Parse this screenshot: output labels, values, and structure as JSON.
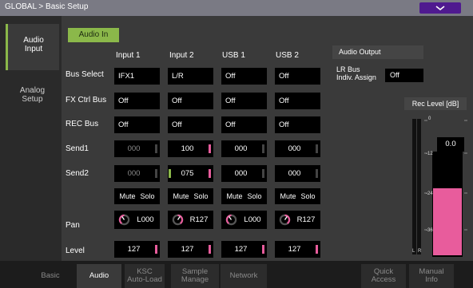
{
  "title": "GLOBAL > Basic Setup",
  "sidebar": {
    "tabs": [
      {
        "label_lines": [
          "Audio",
          "Input"
        ],
        "active": true
      },
      {
        "label_lines": [
          "Analog",
          "Setup"
        ],
        "active": false
      }
    ]
  },
  "audio_in_button": "Audio In",
  "columns": [
    "Input 1",
    "Input 2",
    "USB 1",
    "USB 2"
  ],
  "row_labels": {
    "bus_select": "Bus Select",
    "fx_ctrl_bus": "FX Ctrl Bus",
    "rec_bus": "REC Bus",
    "send1": "Send1",
    "send2": "Send2",
    "pan": "Pan",
    "level": "Level"
  },
  "channels": [
    {
      "bus": "IFX1",
      "fx": "Off",
      "rec": "Off",
      "send1": "000",
      "send2": "000",
      "mute": "Mute",
      "solo": "Solo",
      "pan": "L000",
      "level": "127"
    },
    {
      "bus": "L/R",
      "fx": "Off",
      "rec": "Off",
      "send1": "100",
      "send2": "075",
      "mute": "Mute",
      "solo": "Solo",
      "pan": "R127",
      "level": "127"
    },
    {
      "bus": "Off",
      "fx": "Off",
      "rec": "Off",
      "send1": "000",
      "send2": "000",
      "mute": "Mute",
      "solo": "Solo",
      "pan": "L000",
      "level": "127"
    },
    {
      "bus": "Off",
      "fx": "Off",
      "rec": "Off",
      "send1": "000",
      "send2": "000",
      "mute": "Mute",
      "solo": "Solo",
      "pan": "R127",
      "level": "127"
    }
  ],
  "audio_output": {
    "header": "Audio Output",
    "lr_bus_label_lines": [
      "LR Bus",
      "Indiv. Assign"
    ],
    "lr_bus_value": "Off"
  },
  "rec_level": {
    "header": "Rec Level [dB]",
    "value": "0.0",
    "ticks": [
      "0",
      "-12",
      "-24",
      "-36"
    ],
    "channel_labels": [
      "L",
      "R"
    ],
    "fader_level_fraction": 0.66
  },
  "bottom_tabs": [
    {
      "label_lines": [
        "Basic"
      ],
      "active": false
    },
    {
      "label_lines": [
        "Audio"
      ],
      "active": true
    },
    {
      "label_lines": [
        "KSC",
        "Auto-Load"
      ],
      "active": false
    },
    {
      "label_lines": [
        "Sample",
        "Manage"
      ],
      "active": false
    },
    {
      "label_lines": [
        "Network"
      ],
      "active": false
    },
    {
      "label_lines": [
        "Quick",
        "Access"
      ],
      "active": false
    },
    {
      "label_lines": [
        "Manual",
        "Info"
      ],
      "active": false
    }
  ],
  "colors": {
    "accent_green": "#8bb84a",
    "indicator_pink": "#e85c9c",
    "menu_purple": "#4f1a8f"
  }
}
